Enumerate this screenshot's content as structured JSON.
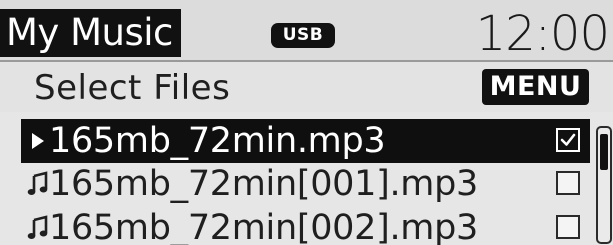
{
  "header": {
    "title": "My Music",
    "source_badge": "USB",
    "clock": "12:00"
  },
  "subheader": {
    "title": "Select Files",
    "menu_label": "MENU"
  },
  "file_list": {
    "items": [
      {
        "name": "165mb_72min.mp3",
        "icon": "play-icon",
        "checked": true,
        "selected": true
      },
      {
        "name": "165mb_72min[001].mp3",
        "icon": "music-note-icon",
        "checked": false,
        "selected": false
      },
      {
        "name": "165mb_72min[002].mp3",
        "icon": "music-note-icon",
        "checked": false,
        "selected": false
      }
    ]
  },
  "colors": {
    "highlight": "#0f0f0f",
    "background": "#e6e6e6",
    "text": "#1f1f1f"
  }
}
